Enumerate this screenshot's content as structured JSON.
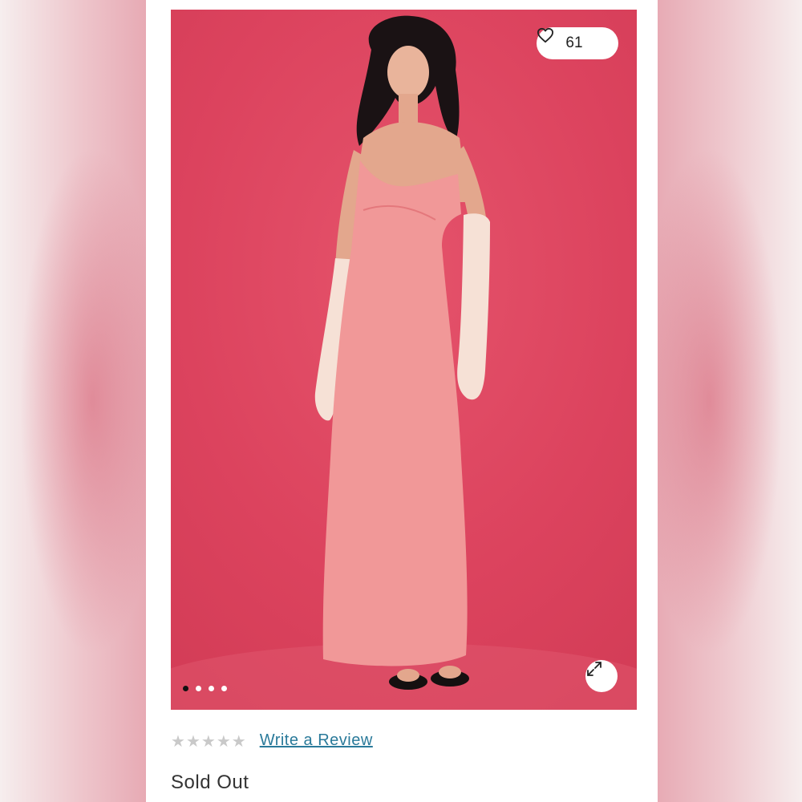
{
  "product": {
    "like_count": "61",
    "gallery_dots": 4,
    "active_image_index": 0,
    "rating_stars_filled": 0,
    "rating_stars_total": 5,
    "review_link": "Write a Review",
    "status": "Sold Out"
  },
  "icons": {
    "like": "heart-icon",
    "expand": "expand-arrows-icon",
    "rating": "star-icon"
  },
  "colors": {
    "backdrop": "#dc435e",
    "dress": "#f08a8a",
    "link": "#2a7a9a",
    "star_empty": "#c9c9c9"
  }
}
